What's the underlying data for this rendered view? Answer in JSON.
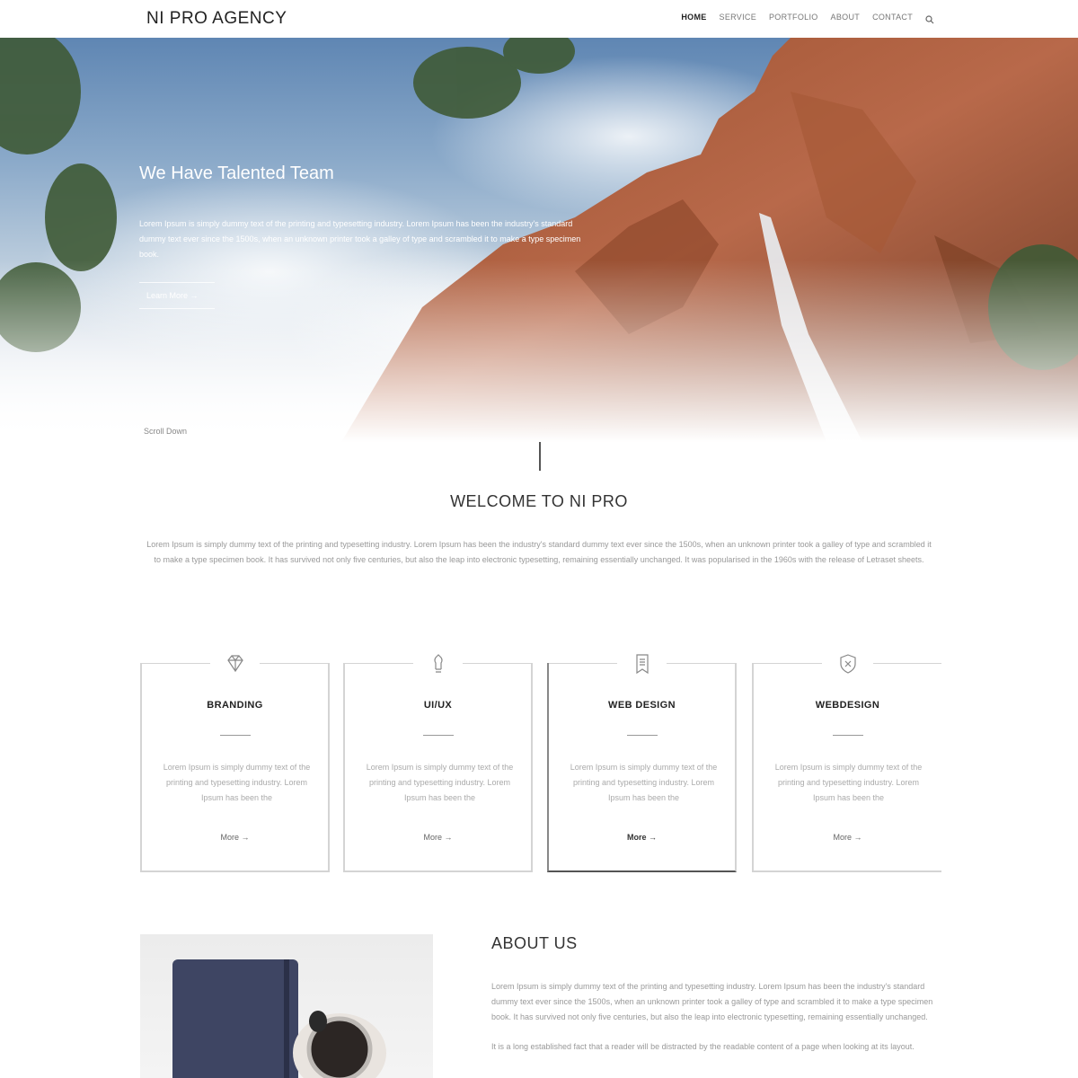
{
  "header": {
    "logo": "NI PRO AGENCY",
    "nav": [
      {
        "label": "HOME",
        "active": true
      },
      {
        "label": "SERVICE",
        "active": false
      },
      {
        "label": "PORTFOLIO",
        "active": false
      },
      {
        "label": "ABOUT",
        "active": false
      },
      {
        "label": "CONTACT",
        "active": false
      }
    ],
    "search_icon": "search-icon"
  },
  "hero": {
    "title": "We Have Talented Team",
    "description": "Lorem Ipsum is simply dummy text of the printing and typesetting industry. Lorem Ipsum has been the industry's standard dummy text ever since the 1500s, when an unknown printer took a galley of type and scrambled it to make a type specimen book.",
    "button": "Learn More →",
    "scroll_label": "Scroll Down"
  },
  "welcome": {
    "title": "WELCOME TO NI PRO",
    "text": "Lorem Ipsum is simply dummy text of the printing and typesetting industry. Lorem Ipsum has been the industry's standard dummy text ever since the 1500s, when an unknown printer took a galley of type and scrambled it to make a type specimen book. It has survived not only five centuries, but also the leap into electronic typesetting, remaining essentially unchanged. It was popularised in the 1960s with the release of Letraset sheets."
  },
  "services": [
    {
      "title": "BRANDING",
      "icon": "diamond-icon",
      "text": "Lorem Ipsum is simply dummy text of the printing and typesetting industry. Lorem Ipsum has been the",
      "link": "More →"
    },
    {
      "title": "UI/UX",
      "icon": "bulb-icon",
      "text": "Lorem Ipsum is simply dummy text of the printing and typesetting industry. Lorem Ipsum has been the",
      "link": "More →"
    },
    {
      "title": "WEB DESIGN",
      "icon": "bookmark-icon",
      "text": "Lorem Ipsum is simply dummy text of the printing and typesetting industry. Lorem Ipsum has been the",
      "link": "More →"
    },
    {
      "title": "WEBDESIGN",
      "icon": "shield-icon",
      "text": "Lorem Ipsum is simply dummy text of the printing and typesetting industry. Lorem Ipsum has been the",
      "link": "More →"
    }
  ],
  "about": {
    "title": "ABOUT US",
    "paragraphs": [
      "Lorem Ipsum is simply dummy text of the printing and typesetting industry. Lorem Ipsum has been the industry's standard dummy text ever since the 1500s, when an unknown printer took a galley of type and scrambled it to make a type specimen book. It has survived not only five centuries, but also the leap into electronic typesetting, remaining essentially unchanged.",
      "It is a long established fact that a reader will be distracted by the readable content of a page when looking at its layout."
    ]
  }
}
